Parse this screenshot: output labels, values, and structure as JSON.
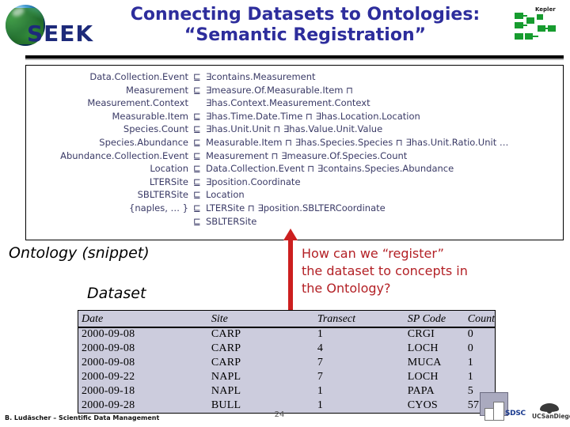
{
  "header": {
    "title_line1": "Connecting Datasets to Ontologies:",
    "title_line2": "“Semantic Registration”",
    "seek_logo_text": "SEEK",
    "kepler_logo_text": "Kepler"
  },
  "ontology": {
    "caption": "Ontology (snippet)",
    "axioms": [
      {
        "lhs": "Data.Collection.Event",
        "op": "⊑",
        "rhs": "∃contains.Measurement"
      },
      {
        "lhs": "Measurement",
        "op": "⊑",
        "rhs": "∃measure.Of.Measurable.Item ⊓"
      },
      {
        "lhs": "Measurement.Context",
        "op": "",
        "rhs": "∃has.Context.Measurement.Context"
      },
      {
        "lhs": "Measurable.Item",
        "op": "⊑",
        "rhs": "∃has.Time.Date.Time ⊓ ∃has.Location.Location"
      },
      {
        "lhs": "Species.Count",
        "op": "⊑",
        "rhs": "∃has.Unit.Unit ⊓ ∃has.Value.Unit.Value"
      },
      {
        "lhs": "Species.Abundance",
        "op": "⊑",
        "rhs": "Measurable.Item ⊓ ∃has.Species.Species ⊓ ∃has.Unit.Ratio.Unit …"
      },
      {
        "lhs": "Abundance.Collection.Event",
        "op": "⊑",
        "rhs": "Measurement ⊓ ∃measure.Of.Species.Count"
      },
      {
        "lhs": "Location",
        "op": "⊑",
        "rhs": "Data.Collection.Event ⊓ ∃contains.Species.Abundance"
      },
      {
        "lhs": "LTERSite",
        "op": "⊑",
        "rhs": "∃position.Coordinate"
      },
      {
        "lhs": "SBLTERSite",
        "op": "⊑",
        "rhs": "Location"
      },
      {
        "lhs": "{naples, … }",
        "op": "⊑",
        "rhs": "LTERSite ⊓ ∃position.SBLTERCoordinate"
      },
      {
        "lhs": "",
        "op": "⊑",
        "rhs": "SBLTERSite"
      }
    ]
  },
  "dataset": {
    "caption": "Dataset",
    "columns": [
      "Date",
      "Site",
      "Transect",
      "SP Code",
      "Count"
    ],
    "rows": [
      [
        "2000-09-08",
        "CARP",
        "1",
        "CRGI",
        "0"
      ],
      [
        "2000-09-08",
        "CARP",
        "4",
        "LOCH",
        "0"
      ],
      [
        "2000-09-08",
        "CARP",
        "7",
        "MUCA",
        "1"
      ],
      [
        "2000-09-22",
        "NAPL",
        "7",
        "LOCH",
        "1"
      ],
      [
        "2000-09-18",
        "NAPL",
        "1",
        "PAPA",
        "5"
      ],
      [
        "2000-09-28",
        "BULL",
        "1",
        "CYOS",
        "57"
      ]
    ]
  },
  "question": {
    "line1": "How can we “register”",
    "line2": "the dataset to concepts in",
    "line3": "the Ontology?"
  },
  "footer": {
    "credit": "B. Ludäscher – Scientific Data Management",
    "page_number": "24",
    "sdsc_label": "SDSC",
    "ucsd_label": "UCSanDiego"
  },
  "colors": {
    "title": "#2d2d9c",
    "ontology_text": "#3a3a66",
    "question": "#b32025",
    "arrow": "#cc1f1f",
    "table_bg": "#ccccdd"
  }
}
